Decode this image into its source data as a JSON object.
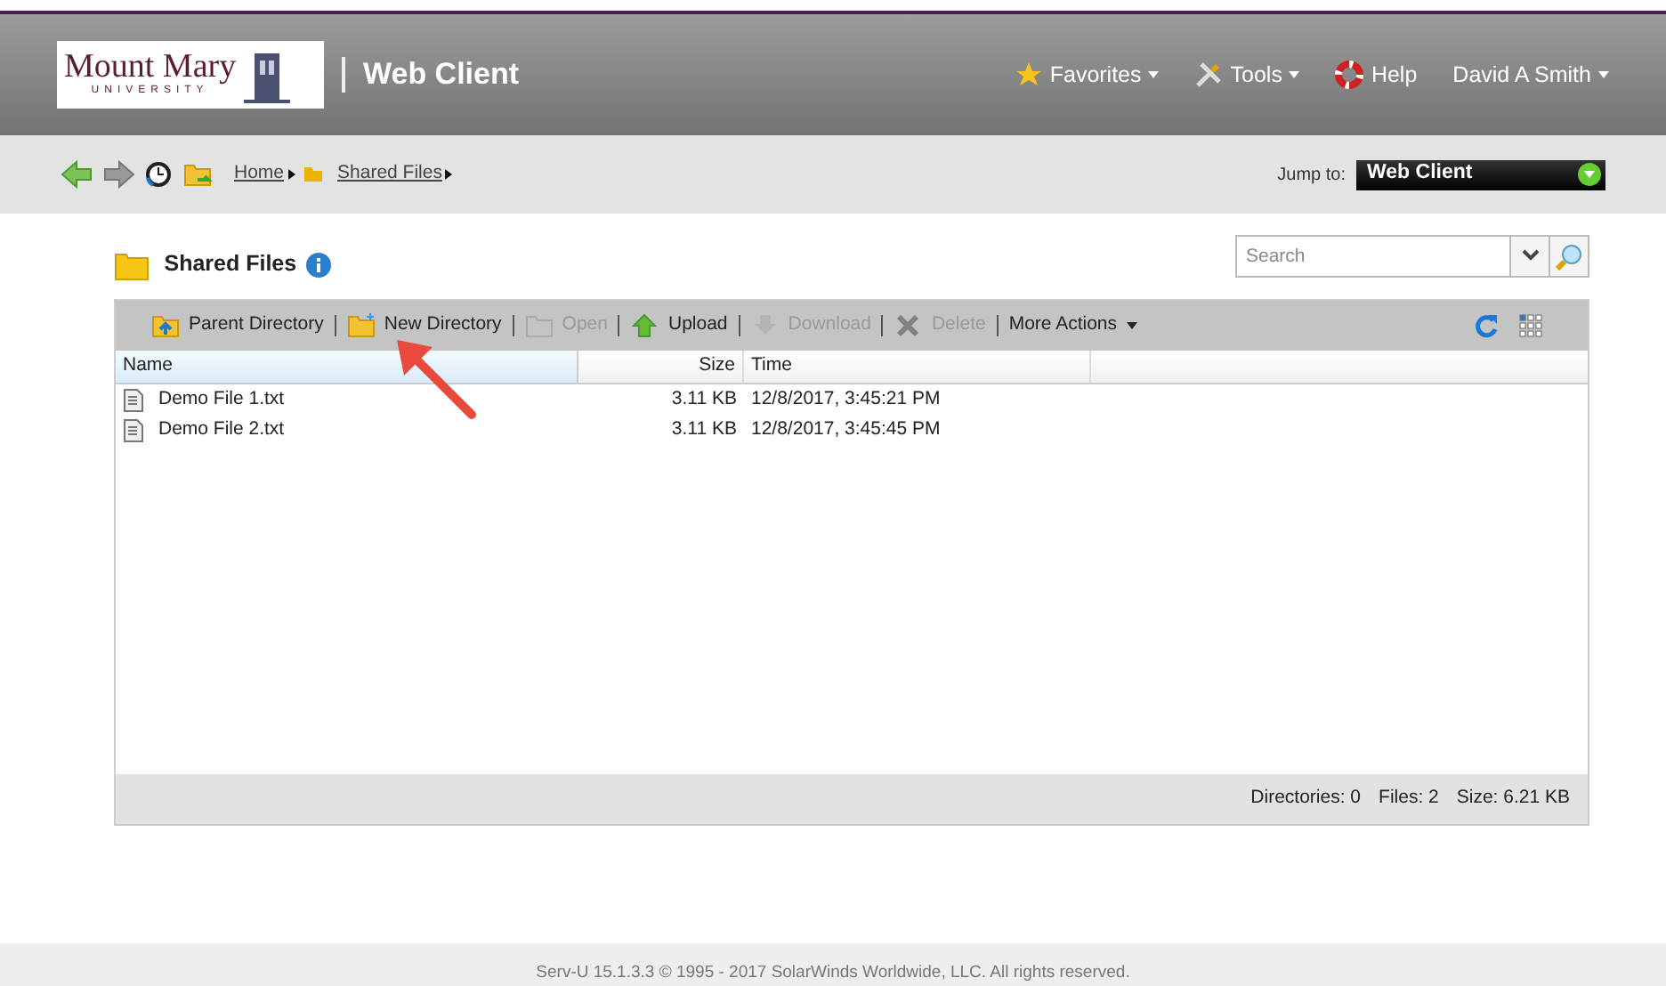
{
  "header": {
    "logo": {
      "name": "Mount Mary",
      "sub": "UNIVERSITY"
    },
    "app_title": "Web Client",
    "menu": [
      {
        "label": "Favorites",
        "dropdown": true
      },
      {
        "label": "Tools",
        "dropdown": true
      },
      {
        "label": "Help",
        "dropdown": false
      },
      {
        "label": "David A Smith",
        "dropdown": true
      }
    ]
  },
  "nav": {
    "breadcrumb": [
      {
        "label": "Home"
      },
      {
        "label": "Shared Files"
      }
    ],
    "jump_to": {
      "label": "Jump to:",
      "value": "Web Client"
    }
  },
  "folder": {
    "title": "Shared Files"
  },
  "search": {
    "placeholder": "Search"
  },
  "toolbar": [
    {
      "label": "Parent Directory",
      "disabled": false
    },
    {
      "label": "New Directory",
      "disabled": false
    },
    {
      "label": "Open",
      "disabled": true
    },
    {
      "label": "Upload",
      "disabled": false
    },
    {
      "label": "Download",
      "disabled": true
    },
    {
      "label": "Delete",
      "disabled": true
    },
    {
      "label": "More Actions",
      "disabled": false
    }
  ],
  "table": {
    "columns": [
      "Name",
      "Size",
      "Time"
    ],
    "rows": [
      [
        "Demo File 1.txt",
        "3.11 KB",
        "12/8/2017, 3:45:21 PM"
      ],
      [
        "Demo File 2.txt",
        "3.11 KB",
        "12/8/2017, 3:45:45 PM"
      ]
    ]
  },
  "summary": [
    "Directories: 0",
    "Files: 2",
    "Size: 6.21 KB"
  ],
  "footer": "Serv-U 15.1.3.3 © 1995 - 2017 SolarWinds Worldwide, LLC. All rights reserved."
}
